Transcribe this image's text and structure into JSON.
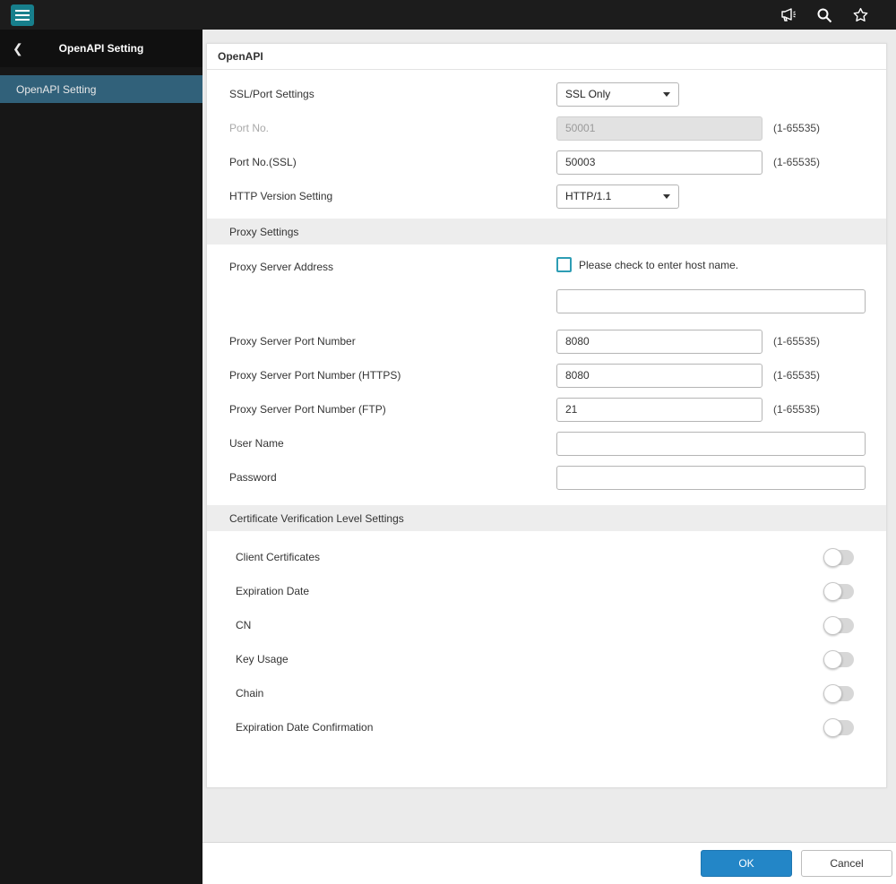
{
  "topbar": {
    "icons": {
      "menu": "hamburger-menu",
      "notification": "megaphone",
      "search": "magnifier",
      "favorite": "star"
    }
  },
  "sidebar": {
    "header": {
      "back_icon": "❮",
      "title": "OpenAPI Setting"
    },
    "items": [
      {
        "label": "OpenAPI Setting",
        "selected": true
      }
    ]
  },
  "page": {
    "card_title": "OpenAPI",
    "fields": {
      "ssl_port": {
        "label": "SSL/Port Settings",
        "value": "SSL Only"
      },
      "port": {
        "label": "Port No.",
        "value": "50001",
        "hint": "(1-65535)",
        "disabled": true
      },
      "port_ssl": {
        "label": "Port No.(SSL)",
        "value": "50003",
        "hint": "(1-65535)"
      },
      "http_version": {
        "label": "HTTP Version Setting",
        "value": "HTTP/1.1"
      }
    },
    "proxy": {
      "section_title": "Proxy Settings",
      "address": {
        "label": "Proxy Server Address",
        "checkbox_label": "Please check to enter host name.",
        "value": ""
      },
      "port": {
        "label": "Proxy Server Port Number",
        "value": "8080",
        "hint": "(1-65535)"
      },
      "port_https": {
        "label": "Proxy Server Port Number (HTTPS)",
        "value": "8080",
        "hint": "(1-65535)"
      },
      "port_ftp": {
        "label": "Proxy Server Port Number (FTP)",
        "value": "21",
        "hint": "(1-65535)"
      },
      "user_name": {
        "label": "User Name",
        "value": ""
      },
      "password": {
        "label": "Password",
        "value": ""
      }
    },
    "cert": {
      "section_title": "Certificate Verification Level Settings",
      "toggles": [
        {
          "label": "Client Certificates",
          "on": false
        },
        {
          "label": "Expiration Date",
          "on": false
        },
        {
          "label": "CN",
          "on": false
        },
        {
          "label": "Key Usage",
          "on": false
        },
        {
          "label": "Chain",
          "on": false
        },
        {
          "label": "Expiration Date Confirmation",
          "on": false
        }
      ]
    }
  },
  "footer": {
    "ok": "OK",
    "cancel": "Cancel"
  },
  "colors": {
    "accent_teal": "#177f8c",
    "selected_item": "#31617a",
    "ok_blue": "#2386c7",
    "checkbox_teal": "#2d9db4"
  }
}
